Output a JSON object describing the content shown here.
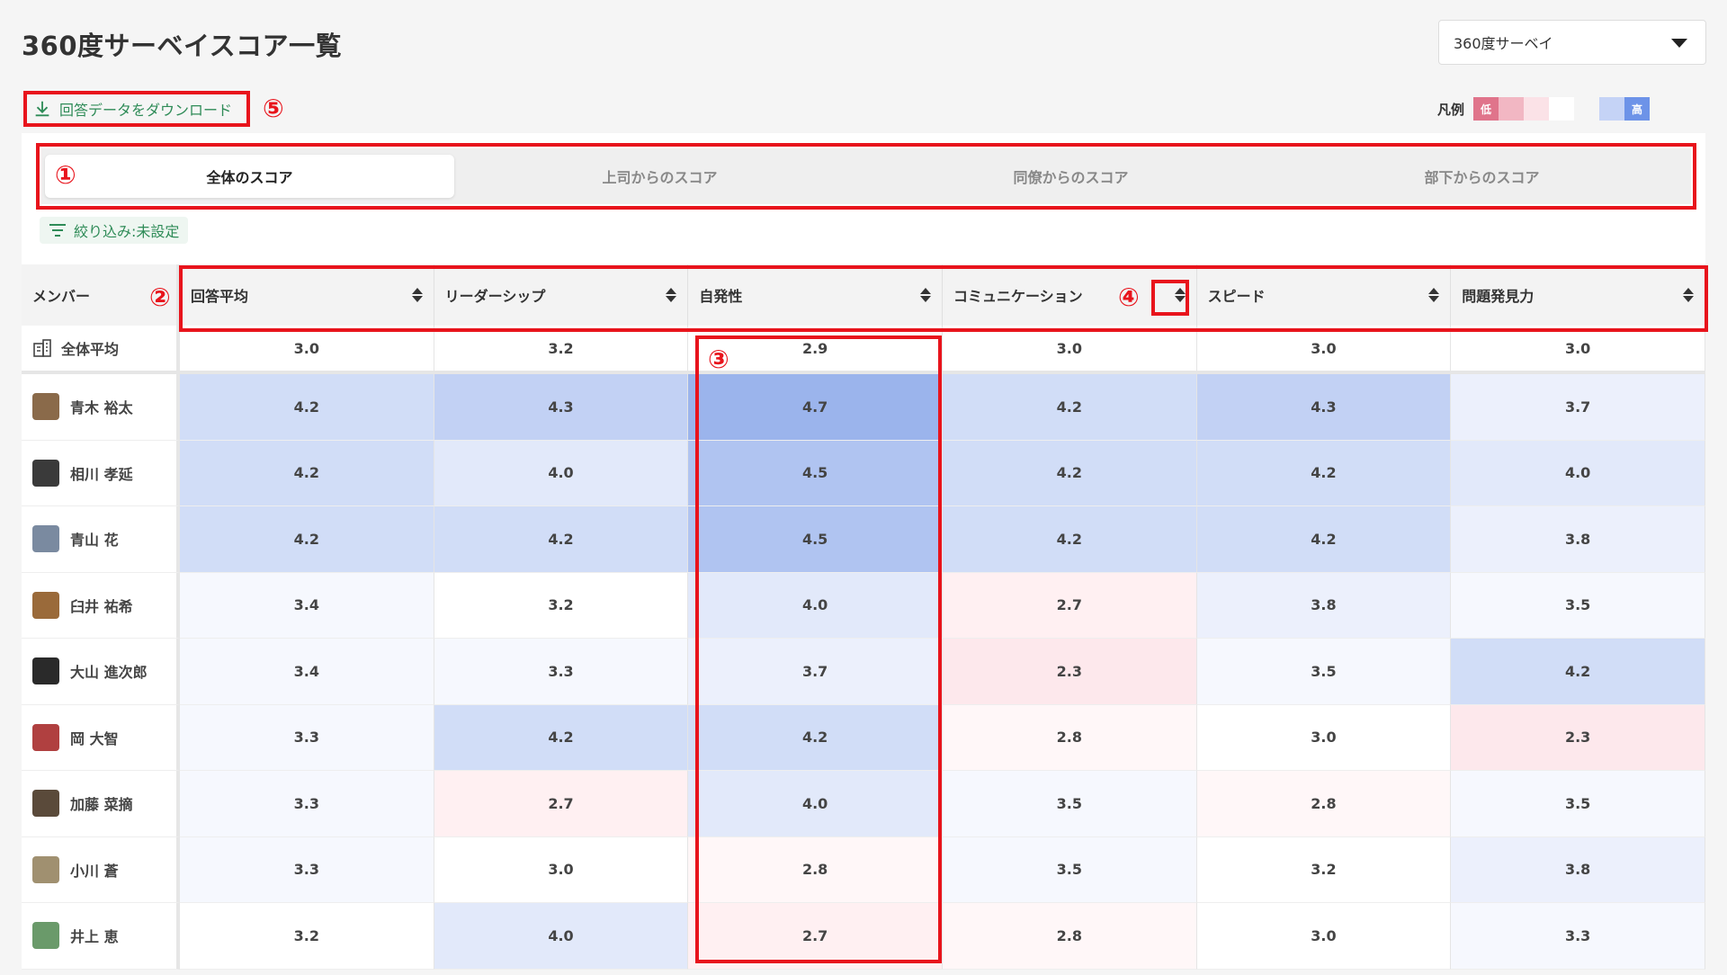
{
  "page": {
    "title": "360度サーベイスコア一覧"
  },
  "survey_select": {
    "value": "360度サーベイ"
  },
  "download": {
    "label": "回答データをダウンロード"
  },
  "legend": {
    "label": "凡例",
    "low": "低",
    "high": "高",
    "colors": [
      "#e0748b",
      "#f2b7c3",
      "#fbe2e7",
      "#ffffff",
      "#c5d3f6",
      "#6d93e8"
    ]
  },
  "annotations": [
    "①",
    "②",
    "③",
    "④",
    "⑤"
  ],
  "tabs": [
    {
      "label": "全体のスコア",
      "active": true
    },
    {
      "label": "上司からのスコア",
      "active": false
    },
    {
      "label": "同僚からのスコア",
      "active": false
    },
    {
      "label": "部下からのスコア",
      "active": false
    }
  ],
  "filter": {
    "label": "絞り込み:未設定"
  },
  "table": {
    "name_header": "メンバー",
    "columns": [
      "回答平均",
      "リーダーシップ",
      "自発性",
      "コミュニケーション",
      "スピード",
      "問題発見力"
    ],
    "average": {
      "label": "全体平均",
      "values": [
        "3.0",
        "3.2",
        "2.9",
        "3.0",
        "3.0",
        "3.0"
      ]
    },
    "rows": [
      {
        "name": "青木 裕太",
        "values": [
          "4.2",
          "4.3",
          "4.7",
          "4.2",
          "4.3",
          "3.7"
        ]
      },
      {
        "name": "相川 孝延",
        "values": [
          "4.2",
          "4.0",
          "4.5",
          "4.2",
          "4.2",
          "4.0"
        ]
      },
      {
        "name": "青山 花",
        "values": [
          "4.2",
          "4.2",
          "4.5",
          "4.2",
          "4.2",
          "3.8"
        ]
      },
      {
        "name": "臼井 祐希",
        "values": [
          "3.4",
          "3.2",
          "4.0",
          "2.7",
          "3.8",
          "3.5"
        ]
      },
      {
        "name": "大山 進次郎",
        "values": [
          "3.4",
          "3.3",
          "3.7",
          "2.3",
          "3.5",
          "4.2"
        ]
      },
      {
        "name": "岡 大智",
        "values": [
          "3.3",
          "4.2",
          "4.2",
          "2.8",
          "3.0",
          "2.3"
        ]
      },
      {
        "name": "加藤 菜摘",
        "values": [
          "3.3",
          "2.7",
          "4.0",
          "3.5",
          "2.8",
          "3.5"
        ]
      },
      {
        "name": "小川 蒼",
        "values": [
          "3.3",
          "3.0",
          "2.8",
          "3.5",
          "3.2",
          "3.8"
        ]
      },
      {
        "name": "井上 恵",
        "values": [
          "3.2",
          "4.0",
          "2.7",
          "2.8",
          "3.0",
          "3.3"
        ]
      }
    ]
  }
}
